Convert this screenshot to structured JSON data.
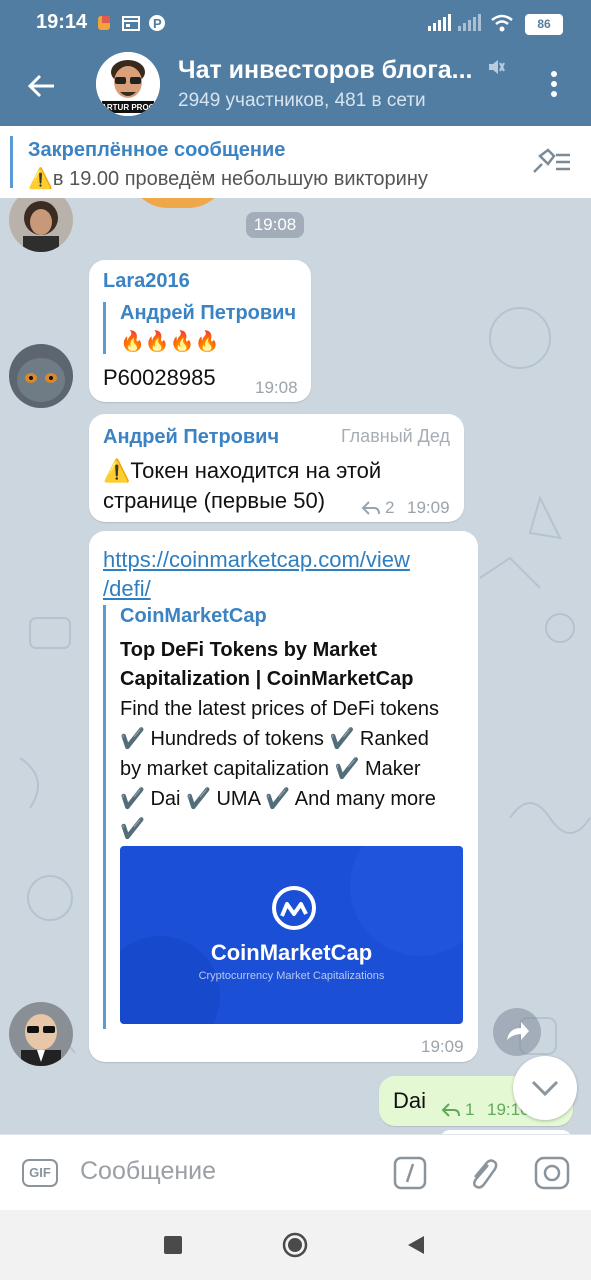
{
  "status": {
    "time": "19:14",
    "battery": "86"
  },
  "header": {
    "title": "Чат инвесторов блога...",
    "subtitle": "2949 участников, 481 в сети",
    "avatar_text": "ARTUR PROG"
  },
  "pinned": {
    "title": "Закреплённое сообщение",
    "text": "⚠️в 19.00 проведём небольшую викторину"
  },
  "messages": {
    "date_chip": "19:08",
    "m1": {
      "sender": "Lara2016",
      "reply_name": "Андрей Петрович",
      "reply_text": "🔥🔥🔥🔥",
      "text": "P60028985",
      "time": "19:08"
    },
    "m2": {
      "sender": "Андрей Петрович",
      "badge": "Главный Дед",
      "text_line1": "⚠️Токен находится на этой",
      "text_line2": "странице (первые 50)",
      "reply_count": "2",
      "time": "19:09"
    },
    "m3": {
      "link_line1": "https://coinmarketcap.com/view",
      "link_line2": "/defi/",
      "site": "CoinMarketCap",
      "title_line1": "Top DeFi Tokens by Market",
      "title_line2": "Capitalization | CoinMarketCap",
      "desc_lines": [
        "Find the latest prices of DeFi tokens",
        "✔️ Hundreds of tokens ✔️ Ranked",
        "by market capitalization ✔️ Maker",
        "✔️ Dai ✔️ UMA ✔️ And many more",
        "✔️"
      ],
      "image_title": "CoinMarketCap",
      "image_subtitle": "Cryptocurrency Market Capitalizations",
      "time": "19:09"
    },
    "m4": {
      "text": "Dai",
      "reply_count": "1",
      "time": "19:10"
    }
  },
  "input": {
    "gif_label": "GIF",
    "placeholder": "Сообщение"
  },
  "colors": {
    "header": "#517da2",
    "accent": "#3b83c3",
    "outgoing": "#e4f9d3",
    "cmc_blue": "#1a4fd6"
  }
}
